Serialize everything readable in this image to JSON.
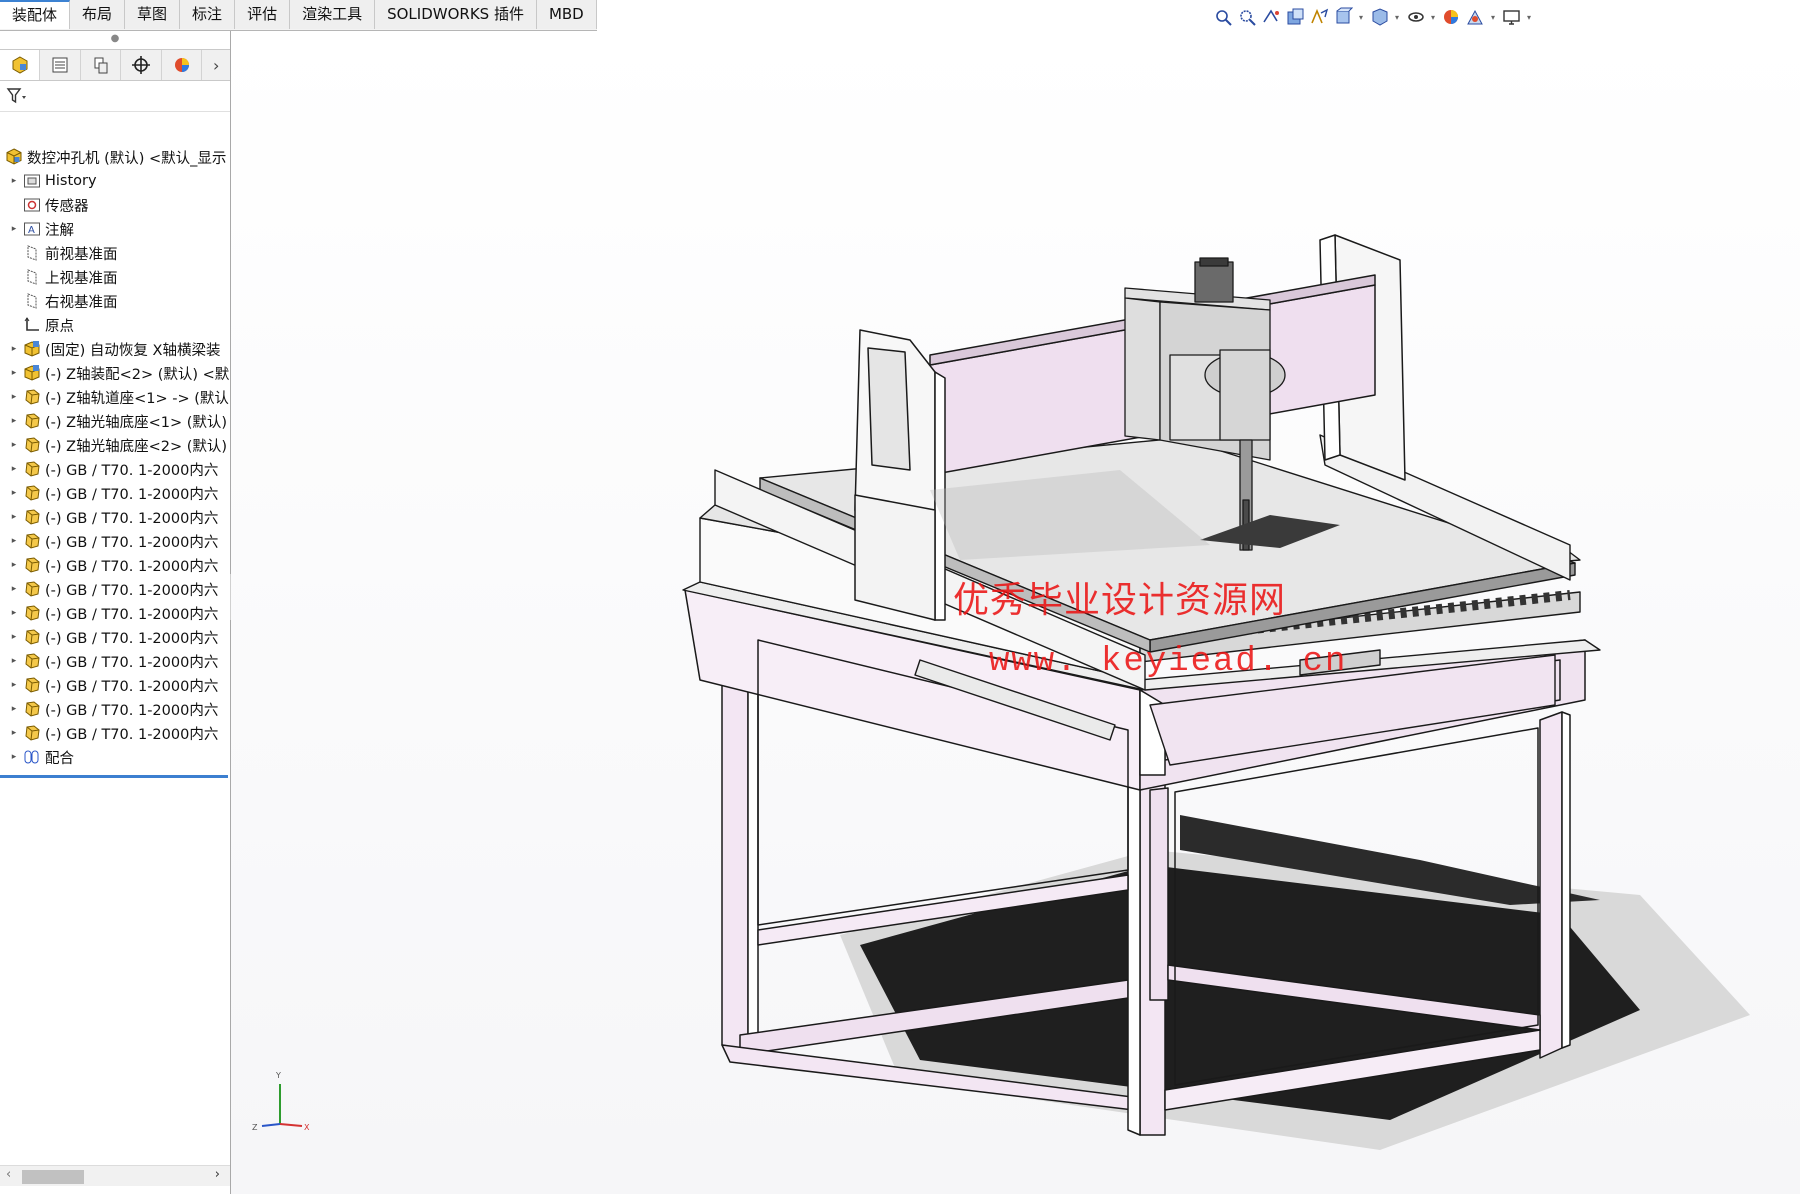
{
  "tabs": [
    "装配体",
    "布局",
    "草图",
    "标注",
    "评估",
    "渲染工具",
    "SOLIDWORKS 插件",
    "MBD"
  ],
  "active_tab": "装配体",
  "view_toolbar_icons": [
    "zoom-to-fit-icon",
    "zoom-to-area-icon",
    "previous-view-icon",
    "section-view-icon",
    "dynamic-annotation-icon",
    "view-orientation-icon",
    "display-style-icon",
    "hide-show-icon",
    "edit-appearance-icon",
    "apply-scene-icon",
    "view-settings-icon"
  ],
  "feature_manager": {
    "tabs": [
      "feature-manager-icon",
      "property-manager-icon",
      "configuration-manager-icon",
      "dimxpert-manager-icon",
      "display-manager-icon"
    ],
    "root": "数控冲孔机 (默认) <默认_显示",
    "items": [
      {
        "label": "History",
        "expand": true,
        "icon": "history-folder-icon"
      },
      {
        "label": "传感器",
        "expand": false,
        "icon": "sensor-folder-icon"
      },
      {
        "label": "注解",
        "expand": true,
        "icon": "annotation-folder-icon"
      },
      {
        "label": "前视基准面",
        "expand": false,
        "icon": "plane-icon"
      },
      {
        "label": "上视基准面",
        "expand": false,
        "icon": "plane-icon"
      },
      {
        "label": "右视基准面",
        "expand": false,
        "icon": "plane-icon"
      },
      {
        "label": "原点",
        "expand": false,
        "icon": "origin-icon"
      },
      {
        "label": "(固定) 自动恢复 X轴横梁装",
        "expand": true,
        "icon": "subassembly-icon"
      },
      {
        "label": "(-) Z轴装配<2> (默认) <默",
        "expand": true,
        "icon": "subassembly-icon"
      },
      {
        "label": "(-) Z轴轨道座<1> -> (默认",
        "expand": true,
        "icon": "part-icon"
      },
      {
        "label": "(-) Z轴光轴底座<1> (默认)",
        "expand": true,
        "icon": "part-icon"
      },
      {
        "label": "(-) Z轴光轴底座<2> (默认)",
        "expand": true,
        "icon": "part-icon"
      },
      {
        "label": "(-) GB / T70. 1-2000内六",
        "expand": true,
        "icon": "part-icon"
      },
      {
        "label": "(-) GB / T70. 1-2000内六",
        "expand": true,
        "icon": "part-icon"
      },
      {
        "label": "(-) GB / T70. 1-2000内六",
        "expand": true,
        "icon": "part-icon"
      },
      {
        "label": "(-) GB / T70. 1-2000内六",
        "expand": true,
        "icon": "part-icon"
      },
      {
        "label": "(-) GB / T70. 1-2000内六",
        "expand": true,
        "icon": "part-icon"
      },
      {
        "label": "(-) GB / T70. 1-2000内六",
        "expand": true,
        "icon": "part-icon"
      },
      {
        "label": "(-) GB / T70. 1-2000内六",
        "expand": true,
        "icon": "part-icon"
      },
      {
        "label": "(-) GB / T70. 1-2000内六",
        "expand": true,
        "icon": "part-icon"
      },
      {
        "label": "(-) GB / T70. 1-2000内六",
        "expand": true,
        "icon": "part-icon"
      },
      {
        "label": "(-) GB / T70. 1-2000内六",
        "expand": true,
        "icon": "part-icon"
      },
      {
        "label": "(-) GB / T70. 1-2000内六",
        "expand": true,
        "icon": "part-icon"
      },
      {
        "label": "(-) GB / T70. 1-2000内六",
        "expand": true,
        "icon": "part-icon"
      },
      {
        "label": "配合",
        "expand": true,
        "icon": "mates-folder-icon"
      }
    ]
  },
  "graphics": {
    "watermark_title": "优秀毕业设计资源网",
    "watermark_url": "www. keyiead. cn",
    "triad_labels": {
      "x": "X",
      "y": "Y",
      "z": "Z"
    },
    "colors": {
      "frame": "#f0e3f0",
      "edge": "#1a1a1a",
      "plate": "#e9e9e9",
      "accent_tab": "#3c82d2"
    }
  }
}
